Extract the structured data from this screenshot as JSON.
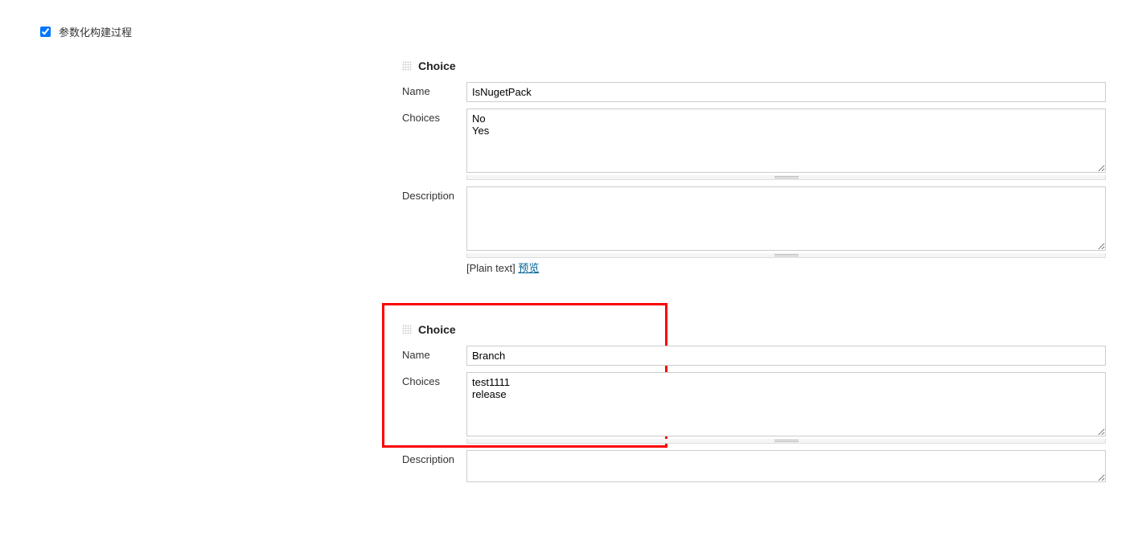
{
  "parameterize_checkbox": {
    "label": "参数化构建过程",
    "checked": true
  },
  "parameters": [
    {
      "type_label": "Choice",
      "fields": {
        "name_label": "Name",
        "name_value": "IsNugetPack",
        "choices_label": "Choices",
        "choices_value": "No\nYes",
        "description_label": "Description",
        "description_value": ""
      },
      "help": {
        "format_text": "[Plain text]",
        "preview_link": "预览"
      }
    },
    {
      "type_label": "Choice",
      "fields": {
        "name_label": "Name",
        "name_value": "Branch",
        "choices_label": "Choices",
        "choices_value": "test1111\nrelease",
        "description_label": "Description",
        "description_value": ""
      }
    }
  ]
}
